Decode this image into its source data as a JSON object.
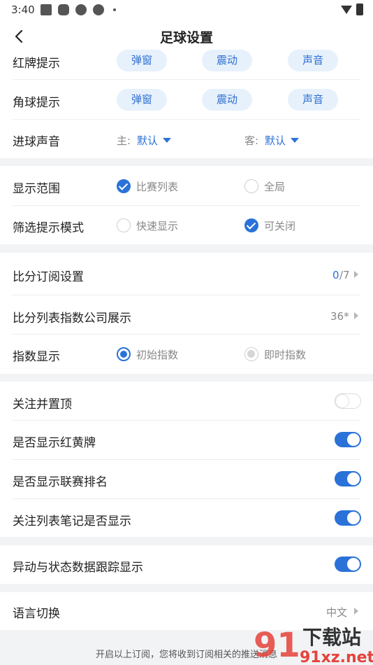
{
  "status_bar": {
    "time": "3:40"
  },
  "nav": {
    "title": "足球设置"
  },
  "alerts": {
    "red_card": {
      "label": "红牌提示",
      "options": [
        "弹窗",
        "震动",
        "声音"
      ]
    },
    "corner": {
      "label": "角球提示",
      "options": [
        "弹窗",
        "震动",
        "声音"
      ]
    },
    "goal_sound": {
      "label": "进球声音",
      "home_prefix": "主:",
      "home_value": "默认",
      "away_prefix": "客:",
      "away_value": "默认"
    }
  },
  "display": {
    "range": {
      "label": "显示范围",
      "opt1": "比赛列表",
      "opt2": "全局",
      "selected": "比赛列表"
    },
    "filter_mode": {
      "label": "筛选提示模式",
      "opt1": "快速显示",
      "opt2": "可关闭",
      "selected": "可关闭"
    }
  },
  "score": {
    "subscription": {
      "label": "比分订阅设置",
      "count": "0",
      "total": "/7"
    },
    "index_company": {
      "label": "比分列表指数公司展示",
      "value": "36*"
    },
    "index_display": {
      "label": "指数显示",
      "opt1": "初始指数",
      "opt2": "即时指数",
      "selected": "初始指数"
    }
  },
  "toggles": [
    {
      "label": "关注并置顶",
      "on": false
    },
    {
      "label": "是否显示红黄牌",
      "on": true
    },
    {
      "label": "是否显示联赛排名",
      "on": true
    },
    {
      "label": "关注列表笔记是否显示",
      "on": true
    }
  ],
  "anomaly": {
    "label": "异动与状态数据跟踪显示",
    "on": true
  },
  "language": {
    "label": "语言切换",
    "value": "中文"
  },
  "footer": {
    "note": "开启以上订阅，您将收到订阅相关的推送消息"
  },
  "watermark": {
    "brand": "91",
    "text": "下载站",
    "url": "91xz.net"
  },
  "colors": {
    "accent": "#2a72d8",
    "pill_bg": "#e6f1fc",
    "page_bg": "#f2f3f5"
  }
}
